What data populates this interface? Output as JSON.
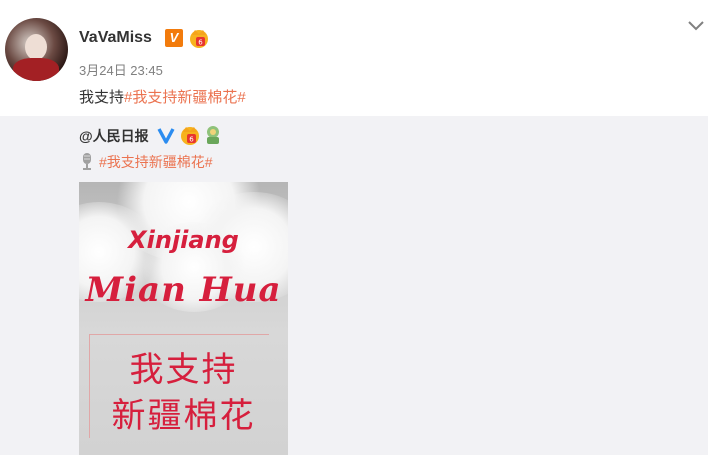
{
  "post": {
    "username": "VaVaMiss",
    "verified_badge": "V",
    "timestamp": "3月24日 23:45",
    "text_prefix": "我支持",
    "topic": "#我支持新疆棉花#",
    "menu_icon": "chevron-down-icon"
  },
  "repost": {
    "author": "@人民日报",
    "topic": "#我支持新疆棉花#",
    "image": {
      "title_line1": "Xinjiang",
      "title_line2": "Mian Hua",
      "cn_line1": "我支持",
      "cn_line2": "新疆棉花"
    }
  },
  "colors": {
    "topic_link": "#eb7350",
    "vip_orange": "#f27b0c",
    "image_red": "#d61f3d",
    "repost_bg": "#f2f2f5"
  }
}
